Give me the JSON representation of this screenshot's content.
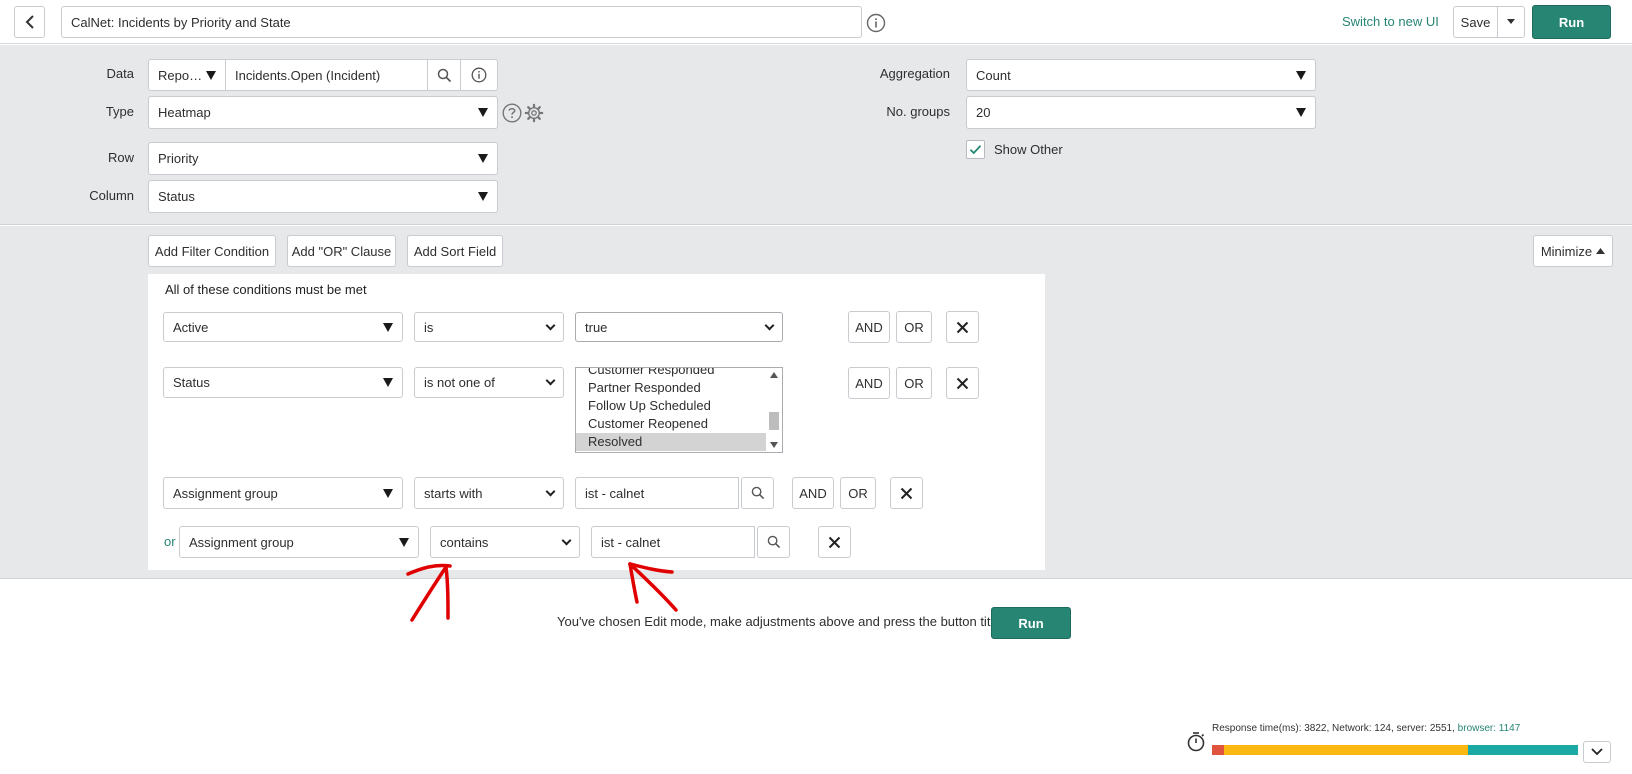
{
  "header": {
    "title_value": "CalNet: Incidents by Priority and State",
    "switch_link": "Switch to new UI",
    "save_label": "Save",
    "run_label": "Run"
  },
  "config": {
    "data_label": "Data",
    "data_source_select": "Repo…",
    "data_source_value": "Incidents.Open (Incident)",
    "type_label": "Type",
    "type_value": "Heatmap",
    "row_label": "Row",
    "row_value": "Priority",
    "column_label": "Column",
    "column_value": "Status",
    "aggregation_label": "Aggregation",
    "aggregation_value": "Count",
    "groups_label": "No. groups",
    "groups_value": "20",
    "show_other_label": "Show Other",
    "show_other_checked": true
  },
  "filter": {
    "add_filter_label": "Add Filter Condition",
    "add_or_label": "Add \"OR\" Clause",
    "add_sort_label": "Add Sort Field",
    "minimize_label": "Minimize",
    "heading": "All of these conditions must be met",
    "and_label": "AND",
    "or_label": "OR",
    "or_prefix": "or",
    "conditions": [
      {
        "field": "Active",
        "operator": "is",
        "value": "true"
      },
      {
        "field": "Status",
        "operator": "is not one of",
        "options": [
          "Customer Responded",
          "Partner Responded",
          "Follow Up Scheduled",
          "Customer Reopened",
          "Resolved"
        ],
        "selected": "Resolved"
      },
      {
        "field": "Assignment group",
        "operator": "starts with",
        "value": "ist - calnet"
      },
      {
        "field": "Assignment group",
        "operator": "contains",
        "value": "ist - calnet"
      }
    ]
  },
  "message": {
    "text": "You've chosen Edit mode, make adjustments above and press the button titled:",
    "run_label": "Run"
  },
  "perf": {
    "text": "Response time(ms): 3822, Network: 124, server: 2551, ",
    "browser": "browser: 1147",
    "network_ms": 124,
    "server_ms": 2551,
    "browser_ms": 1147,
    "colors": {
      "network": "#e0533e",
      "server": "#fcb711",
      "browser": "#1aa9a4"
    }
  },
  "colors": {
    "accent": "#278574",
    "annotation": "#e00000"
  }
}
